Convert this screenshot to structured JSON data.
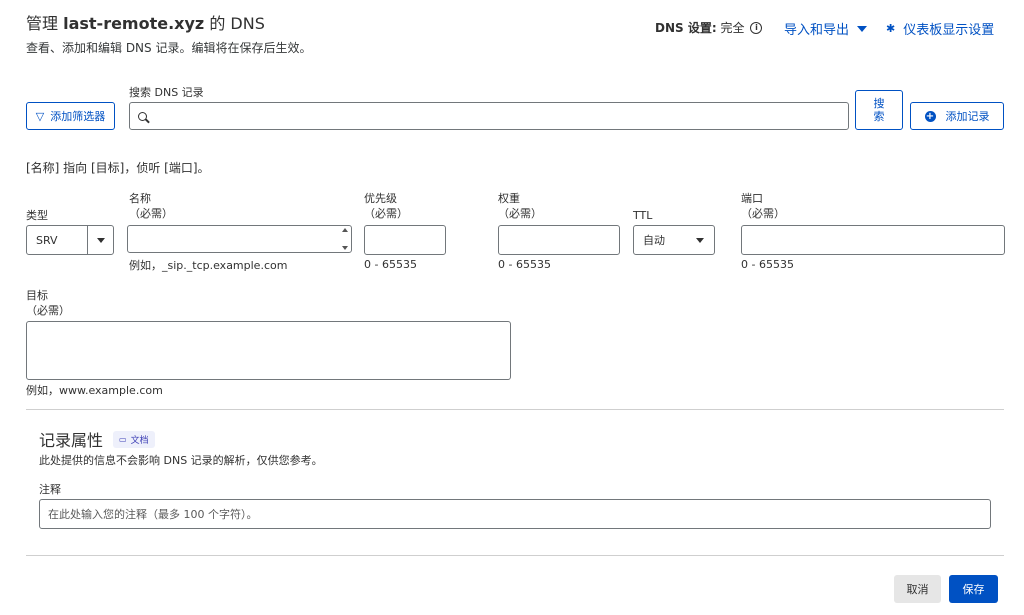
{
  "header": {
    "title_prefix": "管理 ",
    "title_domain": "last-remote.xyz",
    "title_suffix": " 的 DNS",
    "subtitle": "查看、添加和编辑 DNS 记录。编辑将在保存后生效。",
    "dns_setting_label": "DNS 设置:",
    "dns_setting_value": "完全",
    "import_export": "导入和导出",
    "dashboard_settings": "仪表板显示设置"
  },
  "toolbar": {
    "filter_button": "添加筛选器",
    "search_label": "搜索 DNS 记录",
    "search_value": "",
    "search_button_line1": "搜",
    "search_button_line2": "索",
    "add_record": "添加记录"
  },
  "form": {
    "pattern": "[名称] 指向 [目标]，侦听 [端口]。",
    "type": {
      "label": "类型",
      "value": "SRV"
    },
    "name": {
      "label": "名称",
      "required": "（必需）",
      "value": "",
      "hint": "例如，_sip._tcp.example.com"
    },
    "priority": {
      "label": "优先级",
      "required": "（必需）",
      "value": "",
      "hint": "0 - 65535"
    },
    "weight": {
      "label": "权重",
      "required": "（必需）",
      "value": "",
      "hint": "0 - 65535"
    },
    "ttl": {
      "label": "TTL",
      "value": "自动"
    },
    "port": {
      "label": "端口",
      "required": "（必需）",
      "value": "",
      "hint": "0 - 65535"
    },
    "target": {
      "label": "目标",
      "required": "（必需）",
      "value": "",
      "hint": "例如，www.example.com"
    }
  },
  "attributes": {
    "title": "记录属性",
    "docs_badge": "文档",
    "subtitle": "此处提供的信息不会影响 DNS 记录的解析，仅供您参考。",
    "note_label": "注释",
    "note_placeholder": "在此处输入您的注释（最多 100 个字符）。"
  },
  "footer": {
    "cancel": "取消",
    "save": "保存"
  },
  "colors": {
    "accent": "#0051c3",
    "badge_bg": "#eef0fb",
    "badge_text": "#3d3fb5"
  }
}
